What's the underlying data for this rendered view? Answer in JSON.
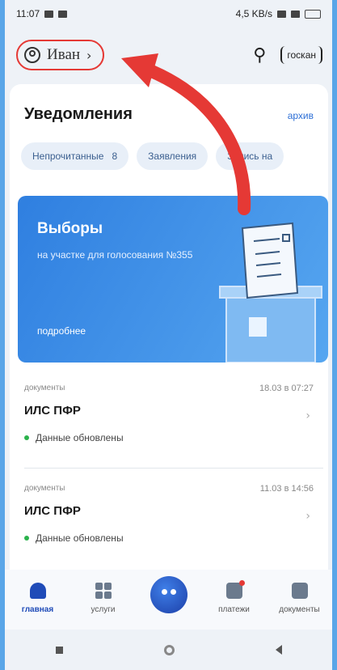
{
  "status_bar": {
    "time": "11:07",
    "speed": "4,5 KB/s"
  },
  "header": {
    "profile_name": "Иван",
    "scan_label": "госкан"
  },
  "notifications": {
    "title": "Уведомления",
    "archive_label": "архив",
    "chips": [
      {
        "label": "Непрочитанные",
        "count": "8"
      },
      {
        "label": "Заявления"
      },
      {
        "label": "Запись на"
      }
    ]
  },
  "banner": {
    "title": "Выборы",
    "subtitle": "на участке для голосования №355",
    "more_label": "подробнее"
  },
  "feed": [
    {
      "category": "документы",
      "date": "18.03 в 07:27",
      "title": "ИЛС ПФР",
      "status": "Данные обновлены"
    },
    {
      "category": "документы",
      "date": "11.03 в 14:56",
      "title": "ИЛС ПФР",
      "status": "Данные обновлены"
    }
  ],
  "bottom_nav": {
    "items": [
      {
        "label": "главная"
      },
      {
        "label": "услуги"
      },
      {
        "label": "платежи"
      },
      {
        "label": "документы"
      }
    ]
  },
  "colors": {
    "accent": "#2d6fd6",
    "annotation": "#e53935",
    "status_ok": "#2bb24c"
  }
}
